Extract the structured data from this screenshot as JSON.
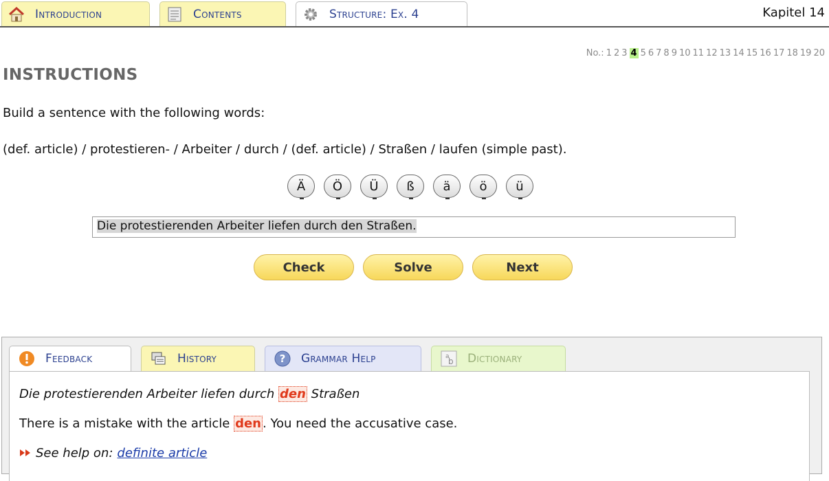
{
  "nav": {
    "tabs": [
      {
        "label": "Introduction",
        "icon": "house-icon"
      },
      {
        "label": "Contents",
        "icon": "document-icon"
      },
      {
        "label": "Structure: Ex. 4",
        "icon": "gear-icon"
      }
    ],
    "chapter": "Kapitel 14"
  },
  "exercise_nav": {
    "label": "No.:",
    "numbers": [
      "1",
      "2",
      "3",
      "4",
      "5",
      "6",
      "7",
      "8",
      "9",
      "10",
      "11",
      "12",
      "13",
      "14",
      "15",
      "16",
      "17",
      "18",
      "19",
      "20"
    ],
    "current": "4"
  },
  "instructions": {
    "heading": "INSTRUCTIONS",
    "prompt": "Build a sentence with the following words:",
    "words": "(def. article) / protestieren- / Arbeiter / durch / (def. article) / Straßen / laufen (simple past)."
  },
  "special_chars": [
    "Ä",
    "Ö",
    "Ü",
    "ß",
    "ä",
    "ö",
    "ü"
  ],
  "answer": {
    "value": "Die protestierenden Arbeiter liefen durch den Straßen."
  },
  "buttons": {
    "check": "Check",
    "solve": "Solve",
    "next": "Next"
  },
  "panel": {
    "tabs": [
      {
        "label": "Feedback",
        "icon": "exclamation-icon",
        "color": "#ffffff"
      },
      {
        "label": "History",
        "icon": "history-icon",
        "color": "#fbf6b4"
      },
      {
        "label": "Grammar Help",
        "icon": "question-icon",
        "color": "#e3e6f7"
      },
      {
        "label": "Dictionary",
        "icon": "dictionary-icon",
        "color": "#e8f7cc"
      }
    ],
    "feedback": {
      "sentence_before": "Die protestierenden Arbeiter liefen durch",
      "sentence_error": "den",
      "sentence_after": "Straßen",
      "msg_before": "There is a mistake with the article",
      "msg_error": "den",
      "msg_after": ". You need the accusative case.",
      "help_prefix": "See help on:",
      "help_link": "definite article"
    }
  },
  "colors": {
    "accent_link": "#1a3ba8",
    "error": "#e03a1c",
    "current_number": "#b8f08a",
    "button": "#f7d75a"
  }
}
